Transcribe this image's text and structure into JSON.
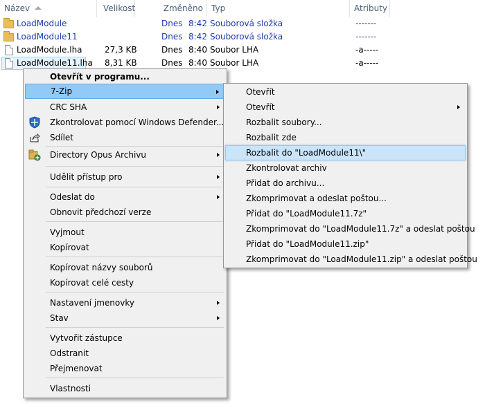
{
  "columns": {
    "name": "Název",
    "size": "Velikost",
    "modified": "Změněno",
    "type": "Typ",
    "attributes": "Atributy"
  },
  "files": [
    {
      "name": "LoadModule",
      "size": "",
      "day": "Dnes",
      "time": "8:42",
      "type": "Souborová složka",
      "attr": "-------",
      "icon": "folder-icon"
    },
    {
      "name": "LoadModule11",
      "size": "",
      "day": "Dnes",
      "time": "8:42",
      "type": "Souborová složka",
      "attr": "-------",
      "icon": "folder-icon"
    },
    {
      "name": "LoadModule.lha",
      "size": "27,3 KB",
      "day": "Dnes",
      "time": "8:40",
      "type": "Soubor LHA",
      "attr": "-a-----",
      "icon": "file-icon"
    },
    {
      "name": "LoadModule11.lha",
      "size": "8,31 KB",
      "day": "Dnes",
      "time": "8:40",
      "type": "Soubor LHA",
      "attr": "-a-----",
      "icon": "file-icon"
    }
  ],
  "context_menu": {
    "items": [
      {
        "label": "Otevřít v programu...",
        "bold": true
      },
      {
        "label": "7-Zip",
        "submenu": true,
        "highlighted": true
      },
      {
        "label": "CRC SHA",
        "submenu": true
      },
      {
        "label": "Zkontrolovat pomocí Windows Defender...",
        "icon": "windows-defender-icon"
      },
      {
        "label": "Sdílet",
        "icon": "share-icon"
      },
      {
        "label": "Directory Opus Archivu",
        "submenu": true,
        "icon": "directory-opus-icon"
      },
      {
        "label": "Udělit přístup pro",
        "submenu": true
      },
      {
        "label": "Odeslat do",
        "submenu": true
      },
      {
        "label": "Obnovit předchozí verze"
      },
      {
        "label": "Vyjmout"
      },
      {
        "label": "Kopírovat"
      },
      {
        "label": "Kopírovat názvy souborů"
      },
      {
        "label": "Kopírovat celé cesty"
      },
      {
        "label": "Nastavení jmenovky",
        "submenu": true
      },
      {
        "label": "Stav",
        "submenu": true
      },
      {
        "label": "Vytvořit zástupce"
      },
      {
        "label": "Odstranit"
      },
      {
        "label": "Přejmenovat"
      },
      {
        "label": "Vlastnosti"
      }
    ]
  },
  "submenu_7zip": {
    "items": [
      {
        "label": "Otevřít"
      },
      {
        "label": "Otevřít",
        "submenu": true
      },
      {
        "label": "Rozbalit soubory..."
      },
      {
        "label": "Rozbalit zde"
      },
      {
        "label": "Rozbalit do \"LoadModule11\\\"",
        "highlighted": true
      },
      {
        "label": "Zkontrolovat archiv"
      },
      {
        "label": "Přidat do archivu..."
      },
      {
        "label": "Zkomprimovat a odeslat poštou..."
      },
      {
        "label": "Přidat do \"LoadModule11.7z\""
      },
      {
        "label": "Zkomprimovat do \"LoadModule11.7z\" a odeslat poštou"
      },
      {
        "label": "Přidat do \"LoadModule11.zip\""
      },
      {
        "label": "Zkomprimovat do \"LoadModule11.zip\" a odeslat poštou"
      }
    ]
  },
  "colors": {
    "folder_text": "#1f3da8",
    "menu_bg": "#f0f0f0",
    "menu_highlight": "#91c9f7"
  }
}
